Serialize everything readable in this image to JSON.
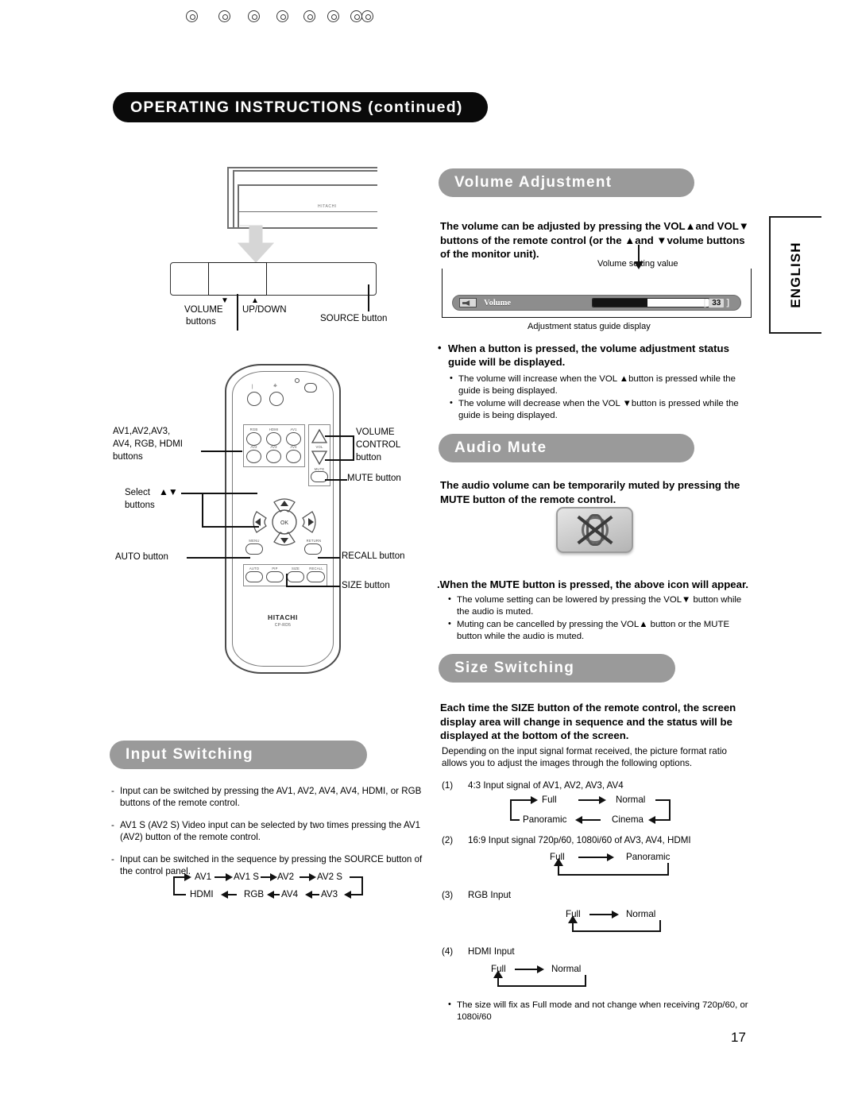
{
  "header": {
    "title": "OPERATING INSTRUCTIONS (continued)"
  },
  "side_tab": {
    "label": "ENGLISH"
  },
  "page_number": "17",
  "monitor_diagram": {
    "brand": "HITACHI",
    "labels": {
      "volume_buttons": "VOLUME",
      "volume_buttons_2": "buttons",
      "updown": "UP/DOWN",
      "source_button": "SOURCE button",
      "down_arrow": "▼",
      "up_arrow": "▲"
    }
  },
  "remote_diagram": {
    "brand": "HITACHI",
    "model": "CP-RD5",
    "button_caps": [
      "RGB",
      "HDMI",
      "AV1",
      "AV2",
      "AV3",
      "AV4"
    ],
    "vol_cap": "VOL",
    "mute_cap": "MUTE",
    "ok_cap": "OK",
    "menu_cap": "MENU",
    "return_cap": "RETURN",
    "fn_caps": [
      "AUTO",
      "PIP",
      "SIZE",
      "RECALL"
    ],
    "callouts": {
      "inputs_line1": "AV1,AV2,AV3,",
      "inputs_line2": "AV4, RGB, HDMI",
      "inputs_line3": "buttons",
      "select_line1": "Select",
      "select_arrows": "▲▼",
      "select_line2": "buttons",
      "auto": "AUTO button",
      "volume_control_l1": "VOLUME",
      "volume_control_l2": "CONTROL",
      "volume_control_l3": "button",
      "mute": "MUTE button",
      "recall": "RECALL button",
      "size": "SIZE button"
    }
  },
  "volume_adjustment": {
    "heading": "Volume Adjustment",
    "intro": "The volume can be adjusted by pressing the VOL▲and VOL▼ buttons of the remote control (or the ▲and ▼volume buttons of the monitor unit).",
    "osd": {
      "caption_top": "Volume setting value",
      "caption_bottom": "Adjustment status guide display",
      "label": "Volume",
      "value": "33",
      "fill_percent": 47,
      "bracket_left": "[",
      "bracket_right": "]"
    },
    "bullet_main": "When a button is pressed, the volume adjustment status guide will be displayed.",
    "sub_bullets": [
      "The volume will increase when the VOL ▲button is pressed while the guide is being displayed.",
      "The volume will decrease when the VOL ▼button is pressed while the guide is being displayed."
    ]
  },
  "audio_mute": {
    "heading": "Audio Mute",
    "intro": "The audio volume can be temporarily muted by pressing the MUTE button of the remote control.",
    "bullet_main": ".When the MUTE button is pressed, the above icon will appear.",
    "sub_bullets": [
      "The volume setting can be lowered by pressing the VOL▼ button while the audio is muted.",
      "Muting can be cancelled by pressing the VOL▲ button or the MUTE button while the audio is muted."
    ]
  },
  "input_switching": {
    "heading": "Input Switching",
    "items": [
      "Input can be switched by pressing the AV1, AV2, AV4, AV4, HDMI, or RGB buttons of the remote control.",
      "AV1 S (AV2 S) Video input can be selected by two times pressing the AV1 (AV2) button of the remote control.",
      "Input can be switched in the sequence by pressing the SOURCE button of the control panel."
    ],
    "sequence": {
      "top_row": [
        "AV1",
        "AV1 S",
        "AV2",
        "AV2 S"
      ],
      "bottom_row": [
        "HDMI",
        "RGB",
        "AV4",
        "AV3"
      ]
    }
  },
  "size_switching": {
    "heading": "Size Switching",
    "intro": "Each time the SIZE button of the remote control, the screen display area will change in sequence and the status will be displayed at the bottom of the screen.",
    "sub_intro": "Depending on the input signal format received, the picture format ratio allows you to adjust the images through the following options.",
    "cases": [
      {
        "num": "(1)",
        "title": "4:3 Input signal of AV1, AV2, AV3, AV4",
        "top_row": [
          "Full",
          "Normal"
        ],
        "bottom_row": [
          "Panoramic",
          "Cinema"
        ]
      },
      {
        "num": "(2)",
        "title": "16:9 Input signal 720p/60, 1080i/60 of AV3, AV4, HDMI",
        "top_row": [
          "Full",
          "Panoramic"
        ]
      },
      {
        "num": "(3)",
        "title": "RGB Input",
        "top_row": [
          "Full",
          "Normal"
        ]
      },
      {
        "num": "(4)",
        "title": "HDMI Input",
        "top_row": [
          "Full",
          "Normal"
        ]
      }
    ],
    "footnote": "The size will fix as Full mode and not change when receiving 720p/60, or 1080i/60"
  },
  "colors": {
    "header_pill": "#0a0a0a",
    "section_pill": "#9a9a9a",
    "osd_bar": "#8d8d8d",
    "ink": "#111111"
  }
}
